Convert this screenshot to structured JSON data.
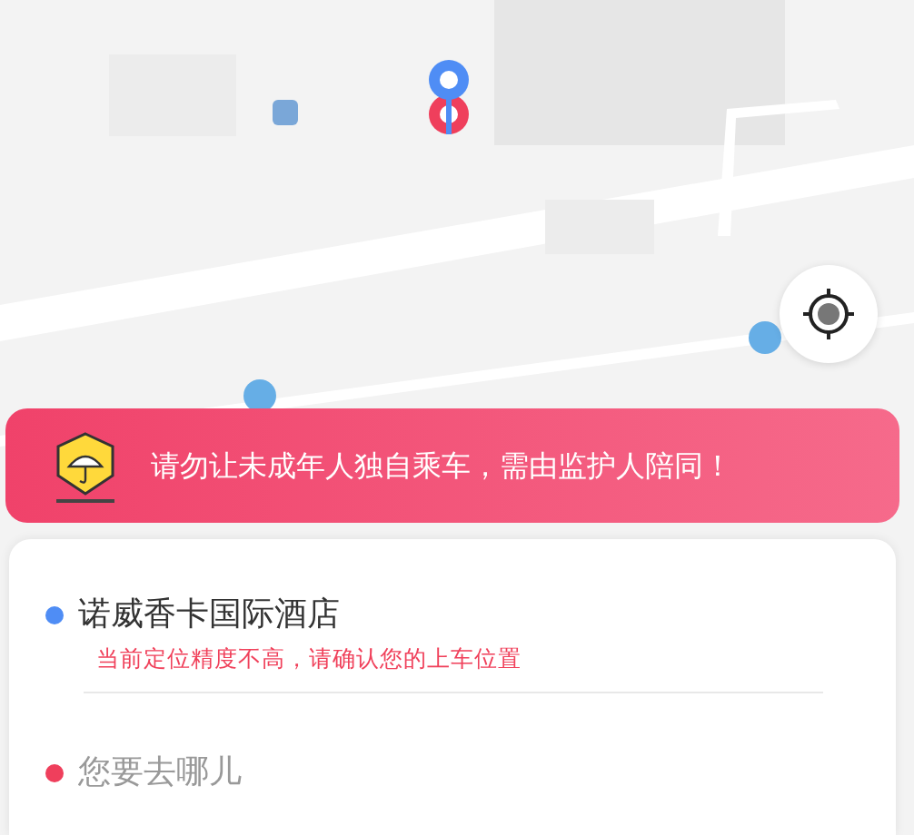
{
  "banner": {
    "text": "请勿让未成年人独自乘车，需由监护人陪同！"
  },
  "pickup": {
    "name": "诺威香卡国际酒店",
    "hint": "当前定位精度不高，请确认您的上车位置",
    "color": "#4f8df5"
  },
  "destination": {
    "placeholder": "您要去哪儿",
    "color": "#ef3f5c"
  }
}
